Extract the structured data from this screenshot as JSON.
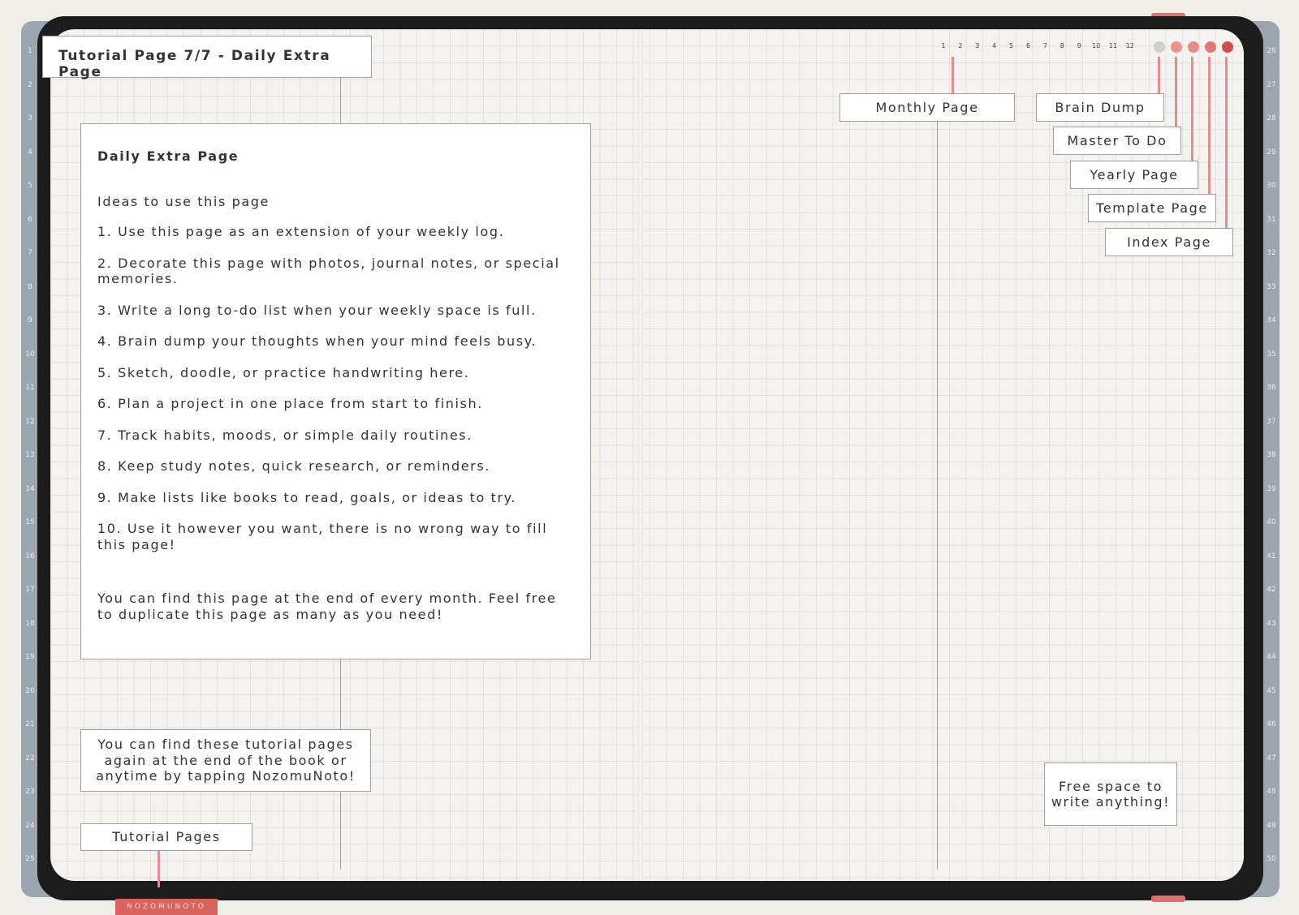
{
  "header": {
    "title": "Tutorial Page 7/7 - Daily Extra Page"
  },
  "card": {
    "title": "Daily Extra Page",
    "subtitle": "Ideas to use this page",
    "items": [
      "1. Use this page as an extension of your weekly log.",
      "2. Decorate this page with photos, journal notes, or special memories.",
      "3. Write a long to-do list when your weekly space is full.",
      "4. Brain dump your thoughts when your mind feels busy.",
      "5. Sketch, doodle, or practice handwriting here.",
      "6. Plan a project in one place from start to finish.",
      "7. Track habits, moods, or simple daily routines.",
      "8. Keep study notes, quick research, or reminders.",
      "9. Make lists like books to read, goals, or ideas to try.",
      "10. Use it however you want, there is no wrong way to fill this page!"
    ],
    "footer": "You can find this page at the end of every month. Feel free to duplicate this page as many as you need!"
  },
  "notes": {
    "tutorial_info": "You can find these tutorial pages again at the end of the book or anytime by tapping NozomuNoto!",
    "tutorial_pages_label": "Tutorial Pages",
    "free_space": "Free space to write anything!"
  },
  "nav": {
    "month_numbers": [
      "1",
      "2",
      "3",
      "4",
      "5",
      "6",
      "7",
      "8",
      "9",
      "10",
      "11",
      "12"
    ],
    "labels": {
      "monthly": "Monthly Page",
      "brain_dump": "Brain Dump",
      "master_todo": "Master To Do",
      "yearly": "Yearly Page",
      "template": "Template Page",
      "index": "Index Page"
    },
    "dot_colors": [
      "#cfcfcf",
      "#f08f8c",
      "#ec8a86",
      "#de7a76",
      "#cc4f4b"
    ]
  },
  "row_numbers_left": [
    "1",
    "2",
    "3",
    "4",
    "5",
    "6",
    "7",
    "8",
    "9",
    "10",
    "11",
    "12",
    "13",
    "14",
    "15",
    "16",
    "17",
    "18",
    "19",
    "20",
    "21",
    "22",
    "23",
    "24",
    "25"
  ],
  "row_numbers_right": [
    "26",
    "27",
    "28",
    "29",
    "30",
    "31",
    "32",
    "33",
    "34",
    "35",
    "36",
    "37",
    "38",
    "39",
    "40",
    "41",
    "42",
    "43",
    "44",
    "45",
    "46",
    "47",
    "48",
    "49",
    "50"
  ],
  "brand": "NOZOMUNOTO",
  "colors": {
    "accent": "#d9645f",
    "connector": "#e08f8b",
    "cover": "#1c1c1c"
  }
}
